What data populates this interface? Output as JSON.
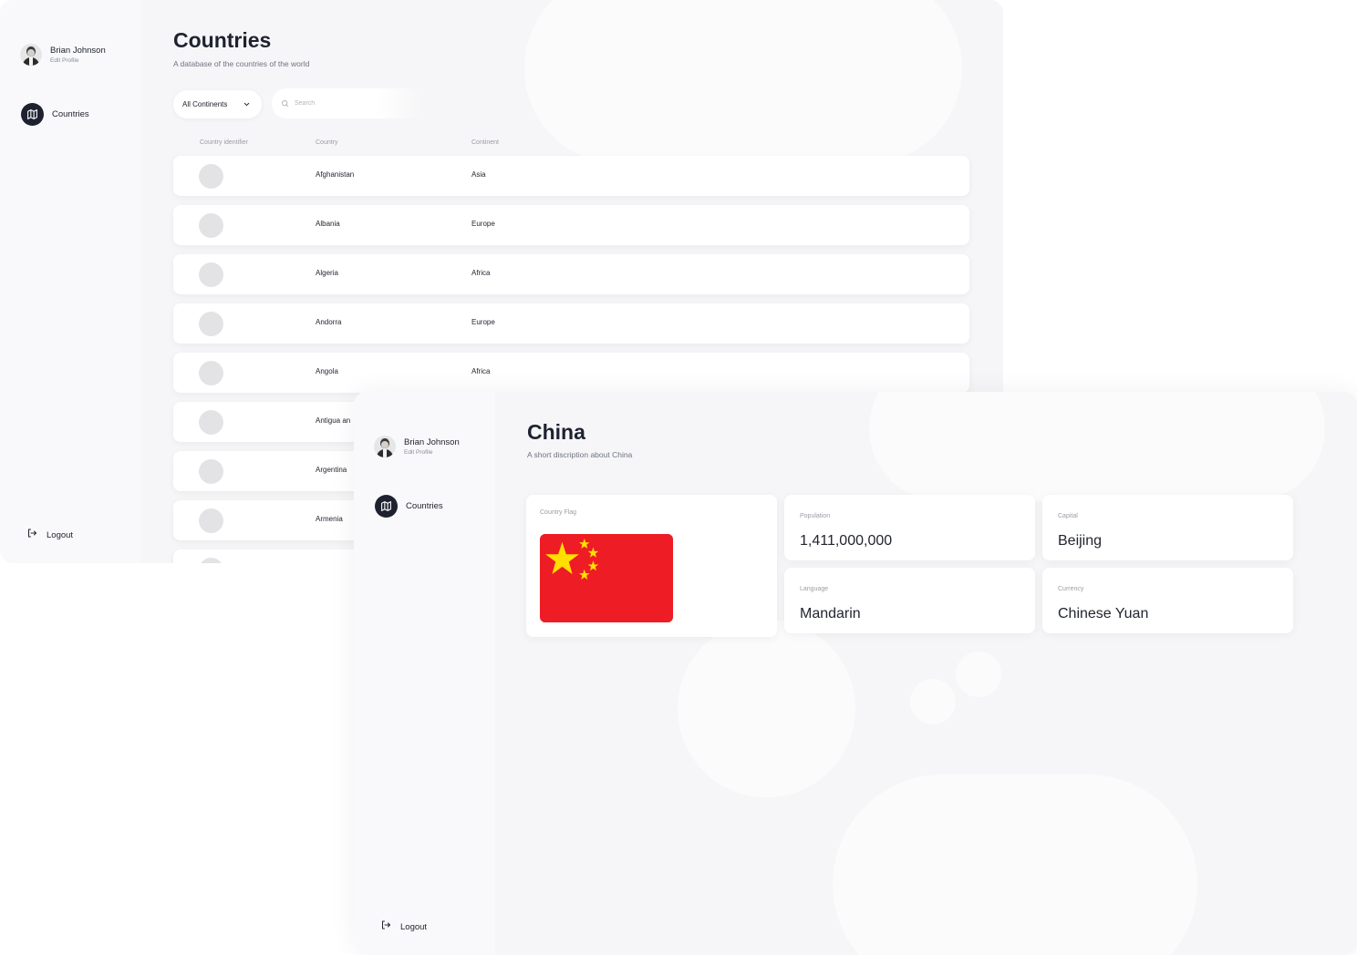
{
  "list_window": {
    "user": {
      "name": "Brian Johnson",
      "edit_label": "Edit Profile"
    },
    "nav": {
      "countries_label": "Countries"
    },
    "logout_label": "Logout",
    "title": "Countries",
    "subtitle": "A database of the countries of the world",
    "filter": {
      "selected": "All Continents"
    },
    "search": {
      "placeholder": "Search"
    },
    "columns": [
      "Country identifier",
      "Country",
      "Continent"
    ],
    "rows": [
      {
        "country": "Afghanistan",
        "continent": "Asia"
      },
      {
        "country": "Albania",
        "continent": "Europe"
      },
      {
        "country": "Algeria",
        "continent": "Africa"
      },
      {
        "country": "Andorra",
        "continent": "Europe"
      },
      {
        "country": "Angola",
        "continent": "Africa"
      },
      {
        "country": "Antigua an",
        "continent": ""
      },
      {
        "country": "Argentina",
        "continent": ""
      },
      {
        "country": "Armenia",
        "continent": ""
      }
    ]
  },
  "detail_window": {
    "user": {
      "name": "Brian Johnson",
      "edit_label": "Edit Profile"
    },
    "nav": {
      "countries_label": "Countries"
    },
    "logout_label": "Logout",
    "title": "China",
    "subtitle": "A short discription about China",
    "flag_label": "Country Flag",
    "flag_colors": {
      "field": "#ee1c25",
      "star": "#ffde00"
    },
    "population": {
      "label": "Population",
      "value": "1,411,000,000"
    },
    "capital": {
      "label": "Capital",
      "value": "Beijing"
    },
    "language": {
      "label": "Language",
      "value": "Mandarin"
    },
    "currency": {
      "label": "Currency",
      "value": "Chinese Yuan"
    }
  },
  "icons": {
    "nav": "map-icon",
    "logout": "logout-icon",
    "search": "search-icon",
    "dropdown": "chevron-down-icon"
  }
}
